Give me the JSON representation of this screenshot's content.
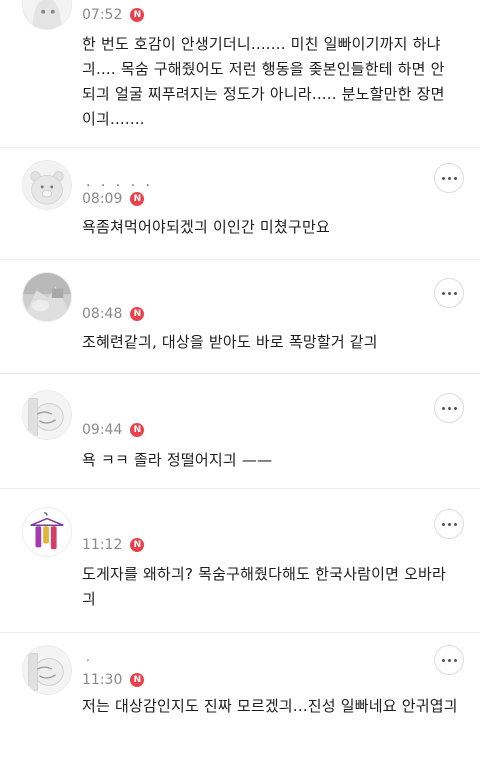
{
  "comments": [
    {
      "time": "07:52",
      "badge": "N",
      "text": "한 번도 호감이 안생기더니....... 미친 일빠이기까지 하냐긔.... 목숨 구해줬어도 저런 행동을 좆본인들한테 하면 안되긔 얼굴 찌푸려지는 정도가 아니라..... 분노할만한 장면이긔......."
    },
    {
      "nickname": ". . . . .",
      "time": "08:09",
      "badge": "N",
      "text": "욕좀쳐먹어야되겠긔 이인간 미쳤구만요"
    },
    {
      "time": "08:48",
      "badge": "N",
      "text": "조혜련같긔, 대상을 받아도 바로 폭망할거 같긔"
    },
    {
      "time": "09:44",
      "badge": "N",
      "text": "욕 ㅋㅋ 졸라 정떨어지긔 ——"
    },
    {
      "time": "11:12",
      "badge": "N",
      "text": "도게자를 왜하긔? 목숨구해줬다해도 한국사람이면 오바라긔"
    },
    {
      "nickname": ".",
      "time": "11:30",
      "badge": "N",
      "text": "저는 대상감인지도 진짜 모르겠긔...진성 일빠네요 안귀엽긔"
    }
  ],
  "icons": {
    "more": "more-horizontal-icon",
    "new": "new-badge-icon"
  },
  "colors": {
    "badge": "#e8434d",
    "divider": "#ebebeb",
    "timestamp": "#8a8a8a"
  }
}
